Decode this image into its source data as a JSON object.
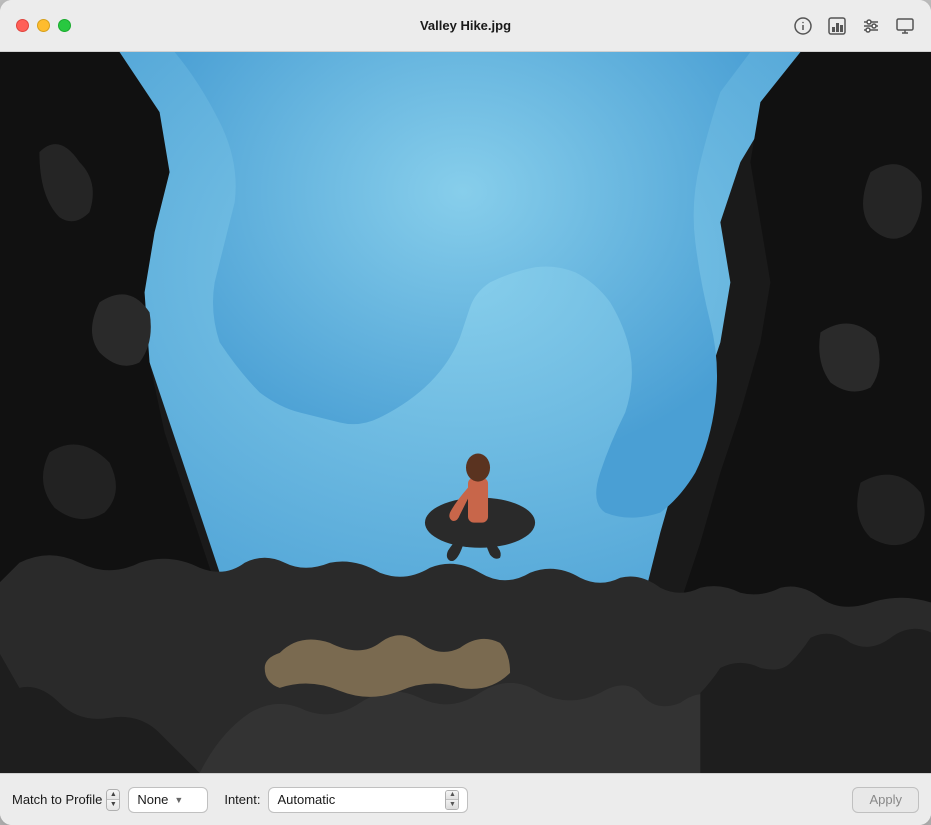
{
  "window": {
    "title": "Valley Hike.jpg"
  },
  "titlebar": {
    "traffic_lights": {
      "close": "close",
      "minimize": "minimize",
      "maximize": "maximize"
    },
    "icons": [
      {
        "name": "info-icon",
        "symbol": "ℹ"
      },
      {
        "name": "histogram-icon",
        "symbol": "⊟"
      },
      {
        "name": "sliders-icon",
        "symbol": "⚙"
      },
      {
        "name": "monitor-icon",
        "symbol": "□"
      }
    ]
  },
  "toolbar": {
    "match_to_profile_label": "Match to Profile",
    "profile_select_value": "None",
    "intent_label": "Intent:",
    "intent_select_value": "Automatic",
    "apply_label": "Apply"
  }
}
